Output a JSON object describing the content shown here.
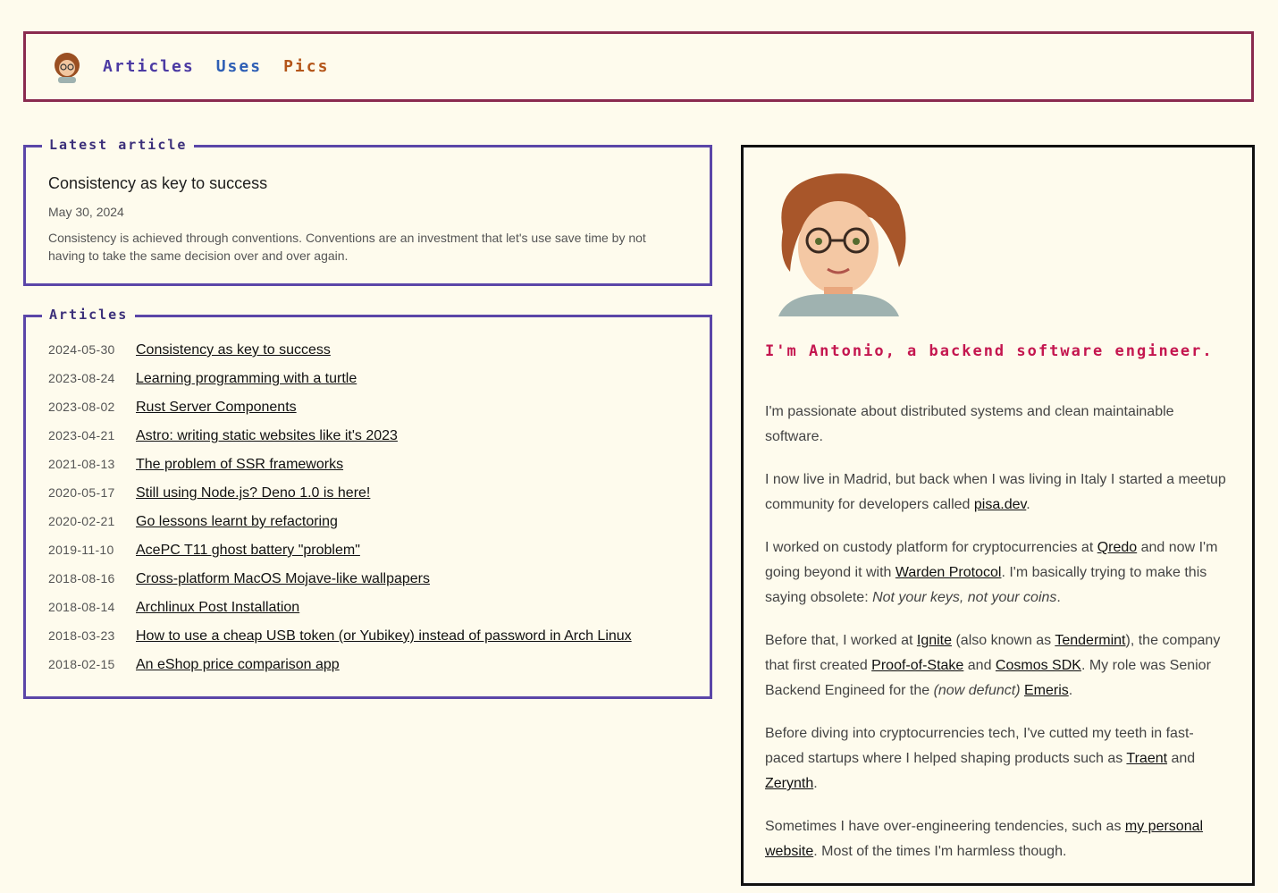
{
  "nav": {
    "items": [
      {
        "label": "Articles",
        "color": "#4b3aa3"
      },
      {
        "label": "Uses",
        "color": "#2e5fb5"
      },
      {
        "label": "Pics",
        "color": "#b4561a"
      }
    ]
  },
  "latest": {
    "legend": "Latest article",
    "title": "Consistency as key to success",
    "date": "May 30, 2024",
    "description": "Consistency is achieved through conventions. Conventions are an investment that let's use save time by not having to take the same decision over and over again."
  },
  "articles": {
    "legend": "Articles",
    "items": [
      {
        "date": "2024-05-30",
        "title": "Consistency as key to success"
      },
      {
        "date": "2023-08-24",
        "title": "Learning programming with a turtle"
      },
      {
        "date": "2023-08-02",
        "title": "Rust Server Components"
      },
      {
        "date": "2023-04-21",
        "title": "Astro: writing static websites like it's 2023"
      },
      {
        "date": "2021-08-13",
        "title": "The problem of SSR frameworks"
      },
      {
        "date": "2020-05-17",
        "title": "Still using Node.js? Deno 1.0 is here!"
      },
      {
        "date": "2020-02-21",
        "title": "Go lessons learnt by refactoring"
      },
      {
        "date": "2019-11-10",
        "title": "AcePC T11 ghost battery \"problem\""
      },
      {
        "date": "2018-08-16",
        "title": "Cross-platform MacOS Mojave-like wallpapers"
      },
      {
        "date": "2018-08-14",
        "title": "Archlinux Post Installation"
      },
      {
        "date": "2018-03-23",
        "title": "How to use a cheap USB token (or Yubikey) instead of password in Arch Linux"
      },
      {
        "date": "2018-02-15",
        "title": "An eShop price comparison app"
      }
    ]
  },
  "about": {
    "headline": "I'm Antonio, a backend software engineer.",
    "p1": "I'm passionate about distributed systems and clean maintainable software.",
    "p2_a": "I now live in Madrid, but back when I was living in Italy I started a meetup community for developers called ",
    "p2_link": "pisa.dev",
    "p2_b": ".",
    "p3_a": "I worked on custody platform for cryptocurrencies at ",
    "p3_link1": "Qredo",
    "p3_b": " and now I'm going beyond it with ",
    "p3_link2": "Warden Protocol",
    "p3_c": ". I'm basically trying to make this saying obsolete: ",
    "p3_em": "Not your keys, not your coins",
    "p3_d": ".",
    "p4_a": "Before that, I worked at ",
    "p4_link1": "Ignite",
    "p4_b": " (also known as ",
    "p4_link2": "Tendermint",
    "p4_c": "), the company that first created ",
    "p4_link3": "Proof-of-Stake",
    "p4_d": " and ",
    "p4_link4": "Cosmos SDK",
    "p4_e": ". My role was Senior Backend Engineed for the ",
    "p4_em": "(now defunct)",
    "p4_f": " ",
    "p4_link5": "Emeris",
    "p4_g": ".",
    "p5_a": "Before diving into cryptocurrencies tech, I've cutted my teeth in fast-paced startups where I helped shaping products such as ",
    "p5_link1": "Traent",
    "p5_b": " and ",
    "p5_link2": "Zerynth",
    "p5_c": ".",
    "p6_a": "Sometimes I have over-engineering tendencies, such as ",
    "p6_link": "my personal website",
    "p6_b": ". Most of the times I'm harmless though."
  }
}
